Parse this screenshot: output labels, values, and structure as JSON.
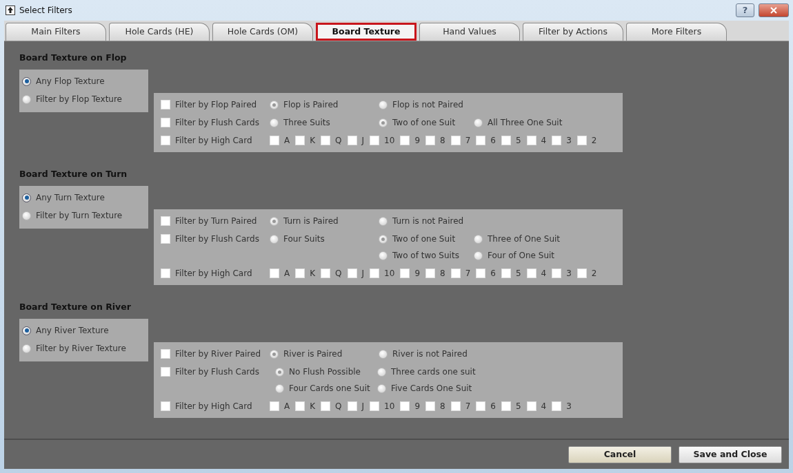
{
  "window": {
    "title": "Select Filters",
    "help_button": "?"
  },
  "tabs": [
    {
      "label": "Main Filters",
      "selected": false
    },
    {
      "label": "Hole Cards (HE)",
      "selected": false
    },
    {
      "label": "Hole Cards (OM)",
      "selected": false
    },
    {
      "label": "Board Texture",
      "selected": true
    },
    {
      "label": "Hand Values",
      "selected": false
    },
    {
      "label": "Filter by Actions",
      "selected": false
    },
    {
      "label": "More Filters",
      "selected": false
    }
  ],
  "sections": [
    {
      "heading": "Board Texture on Flop",
      "modes": [
        {
          "label": "Any Flop Texture",
          "selected": true
        },
        {
          "label": "Filter by Flop Texture",
          "selected": false
        }
      ],
      "rows": [
        {
          "kind": "radios",
          "label": "Filter by Flop Paired",
          "checked": false,
          "lines": [
            [
              {
                "label": "Flop is Paired",
                "selected": true
              },
              {
                "label": "Flop is not Paired",
                "selected": false
              }
            ]
          ]
        },
        {
          "kind": "radios",
          "label": "Filter by Flush Cards",
          "checked": false,
          "lines": [
            [
              {
                "label": "Three Suits",
                "selected": false
              },
              {
                "label": "Two of one Suit",
                "selected": true
              },
              {
                "label": "All Three One Suit",
                "selected": false
              }
            ]
          ]
        },
        {
          "kind": "cards",
          "label": "Filter by High Card",
          "checked": false,
          "cards": [
            {
              "label": "A",
              "checked": false
            },
            {
              "label": "K",
              "checked": false
            },
            {
              "label": "Q",
              "checked": false
            },
            {
              "label": "J",
              "checked": false
            },
            {
              "label": "10",
              "checked": false
            },
            {
              "label": "9",
              "checked": false
            },
            {
              "label": "8",
              "checked": false
            },
            {
              "label": "7",
              "checked": false
            },
            {
              "label": "6",
              "checked": false
            },
            {
              "label": "5",
              "checked": false
            },
            {
              "label": "4",
              "checked": false
            },
            {
              "label": "3",
              "checked": false
            },
            {
              "label": "2",
              "checked": false
            }
          ]
        }
      ]
    },
    {
      "heading": "Board Texture on Turn",
      "modes": [
        {
          "label": "Any Turn Texture",
          "selected": true
        },
        {
          "label": "Filter by Turn Texture",
          "selected": false
        }
      ],
      "rows": [
        {
          "kind": "radios",
          "label": "Filter by Turn Paired",
          "checked": false,
          "lines": [
            [
              {
                "label": "Turn is Paired",
                "selected": true
              },
              {
                "label": "Turn is not Paired",
                "selected": false
              }
            ]
          ]
        },
        {
          "kind": "radios",
          "label": "Filter by Flush Cards",
          "checked": false,
          "lines": [
            [
              {
                "label": "Four Suits",
                "selected": false
              },
              {
                "label": "Two of one Suit",
                "selected": true
              },
              {
                "label": "Three of One Suit",
                "selected": false
              }
            ],
            [
              {
                "label": "Two of two Suits",
                "selected": false
              },
              {
                "label": "Four of One Suit",
                "selected": false
              }
            ]
          ]
        },
        {
          "kind": "cards",
          "label": "Filter by High Card",
          "checked": false,
          "cards": [
            {
              "label": "A",
              "checked": false
            },
            {
              "label": "K",
              "checked": false
            },
            {
              "label": "Q",
              "checked": false
            },
            {
              "label": "J",
              "checked": false
            },
            {
              "label": "10",
              "checked": false
            },
            {
              "label": "9",
              "checked": false
            },
            {
              "label": "8",
              "checked": false
            },
            {
              "label": "7",
              "checked": false
            },
            {
              "label": "6",
              "checked": false
            },
            {
              "label": "5",
              "checked": false
            },
            {
              "label": "4",
              "checked": false
            },
            {
              "label": "3",
              "checked": false
            },
            {
              "label": "2",
              "checked": false
            }
          ]
        }
      ]
    },
    {
      "heading": "Board Texture on River",
      "modes": [
        {
          "label": "Any River Texture",
          "selected": true
        },
        {
          "label": "Filter by River Texture",
          "selected": false
        }
      ],
      "rows": [
        {
          "kind": "radios",
          "label": "Filter by River Paired",
          "checked": false,
          "lines": [
            [
              {
                "label": "River is Paired",
                "selected": true
              },
              {
                "label": "River is not Paired",
                "selected": false
              }
            ]
          ]
        },
        {
          "kind": "grid",
          "label": "Filter by Flush Cards",
          "checked": false,
          "lines": [
            [
              {
                "label": "No Flush Possible",
                "selected": true
              },
              {
                "label": "Three cards one suit",
                "selected": false
              }
            ],
            [
              {
                "label": "Four Cards one Suit",
                "selected": false
              },
              {
                "label": "Five Cards One Suit",
                "selected": false
              }
            ]
          ]
        },
        {
          "kind": "cards",
          "label": "Filter by High Card",
          "checked": false,
          "cards": [
            {
              "label": "A",
              "checked": false
            },
            {
              "label": "K",
              "checked": false
            },
            {
              "label": "Q",
              "checked": false
            },
            {
              "label": "J",
              "checked": false
            },
            {
              "label": "10",
              "checked": false
            },
            {
              "label": "9",
              "checked": false
            },
            {
              "label": "8",
              "checked": false
            },
            {
              "label": "7",
              "checked": false
            },
            {
              "label": "6",
              "checked": false
            },
            {
              "label": "5",
              "checked": false
            },
            {
              "label": "4",
              "checked": false
            },
            {
              "label": "3",
              "checked": false
            }
          ]
        }
      ]
    }
  ],
  "buttons": [
    {
      "label": "Cancel"
    },
    {
      "label": "Save and Close"
    }
  ]
}
